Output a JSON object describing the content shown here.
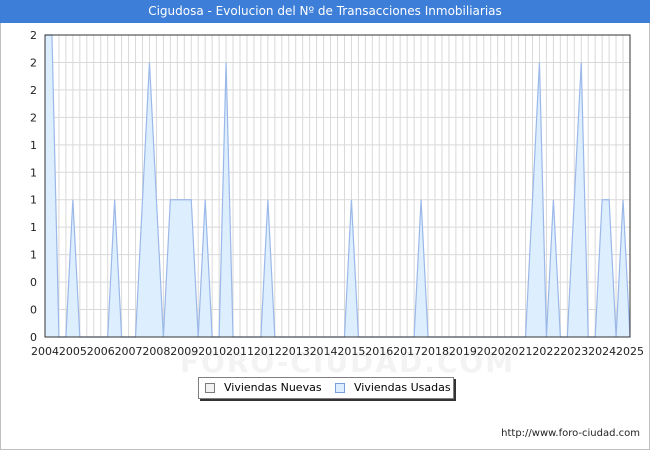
{
  "title": "Cigudosa - Evolucion del Nº de Transacciones Inmobiliarias",
  "source": "http://www.foro-ciudad.com",
  "watermark": "FORO-CIUDAD.COM",
  "legend": [
    {
      "label": "Viviendas Nuevas",
      "color": "#f2f2f2",
      "border": "#7a7a7a"
    },
    {
      "label": "Viviendas Usadas",
      "color": "#ddeeff",
      "border": "#7a9fd8"
    }
  ],
  "chart_data": {
    "type": "area",
    "title": "Cigudosa - Evolucion del Nº de Transacciones Inmobiliarias",
    "xlabel": "",
    "ylabel": "",
    "x_tick_labels": [
      "2004",
      "2005",
      "2006",
      "2007",
      "2008",
      "2009",
      "2010",
      "2011",
      "2012",
      "2013",
      "2014",
      "2015",
      "2016",
      "2017",
      "2018",
      "2019",
      "2020",
      "2021",
      "2022",
      "2023",
      "2024",
      "2025"
    ],
    "y_tick_labels": [
      "0",
      "0",
      "0",
      "1",
      "1",
      "1",
      "1",
      "1",
      "2",
      "2",
      "2",
      "2"
    ],
    "ylim": [
      0,
      2.2
    ],
    "xlim": [
      2004,
      2025
    ],
    "grid": true,
    "legend_position": "bottom-center",
    "series": [
      {
        "name": "Viviendas Nuevas",
        "color": "#7a7a7a",
        "points": []
      },
      {
        "name": "Viviendas Usadas",
        "color": "#9bb8e8",
        "fill": "#ddeeff",
        "points": [
          [
            2004.0,
            2.2
          ],
          [
            2004.25,
            2.2
          ],
          [
            2004.5,
            0
          ],
          [
            2004.75,
            0
          ],
          [
            2005.0,
            1
          ],
          [
            2005.25,
            0
          ],
          [
            2005.5,
            0
          ],
          [
            2006.0,
            0
          ],
          [
            2006.25,
            0
          ],
          [
            2006.5,
            1
          ],
          [
            2006.75,
            0
          ],
          [
            2007.25,
            0
          ],
          [
            2007.75,
            2
          ],
          [
            2008.25,
            0
          ],
          [
            2008.5,
            1
          ],
          [
            2009.0,
            1
          ],
          [
            2009.25,
            1
          ],
          [
            2009.5,
            0
          ],
          [
            2009.75,
            1
          ],
          [
            2010.0,
            0
          ],
          [
            2010.25,
            0
          ],
          [
            2010.5,
            2
          ],
          [
            2010.75,
            0
          ],
          [
            2011.75,
            0
          ],
          [
            2012.0,
            1
          ],
          [
            2012.25,
            0
          ],
          [
            2014.75,
            0
          ],
          [
            2015.0,
            1
          ],
          [
            2015.25,
            0
          ],
          [
            2017.25,
            0
          ],
          [
            2017.5,
            1
          ],
          [
            2017.75,
            0
          ],
          [
            2021.25,
            0
          ],
          [
            2021.75,
            2
          ],
          [
            2022.0,
            0
          ],
          [
            2022.25,
            1
          ],
          [
            2022.5,
            0
          ],
          [
            2022.75,
            0
          ],
          [
            2023.25,
            2
          ],
          [
            2023.5,
            0
          ],
          [
            2023.75,
            0
          ],
          [
            2024.0,
            1
          ],
          [
            2024.25,
            1
          ],
          [
            2024.5,
            0
          ],
          [
            2024.75,
            1
          ],
          [
            2025.0,
            0
          ]
        ]
      }
    ]
  }
}
